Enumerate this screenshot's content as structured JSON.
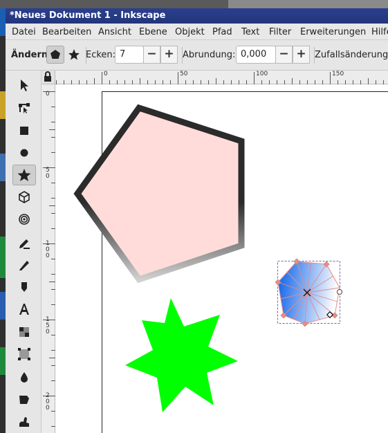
{
  "window": {
    "title": "*Neues Dokument 1 - Inkscape"
  },
  "menubar": {
    "items": [
      "Datei",
      "Bearbeiten",
      "Ansicht",
      "Ebene",
      "Objekt",
      "Pfad",
      "Text",
      "Filter",
      "Erweiterungen",
      "Hilfe"
    ]
  },
  "controls": {
    "change_label": "Ändern:",
    "corners_label": "Ecken:",
    "corners_value": "7",
    "rounding_label": "Abrundung:",
    "rounding_value": "0,000",
    "randomize_label": "Zufallsänderung:",
    "minus": "−",
    "plus": "+"
  },
  "rulers": {
    "horizontal": [
      "0",
      "50",
      "100",
      "150"
    ],
    "vertical": [
      "0",
      "5\n0",
      "1\n0\n0",
      "1\n5\n0",
      "2\n0\n0"
    ]
  },
  "colors": {
    "pentagon_fill": "#ffdcd9",
    "star_fill": "#00ff00",
    "gradient_start": "#0a5fe8",
    "gradient_end": "#ffffff"
  }
}
